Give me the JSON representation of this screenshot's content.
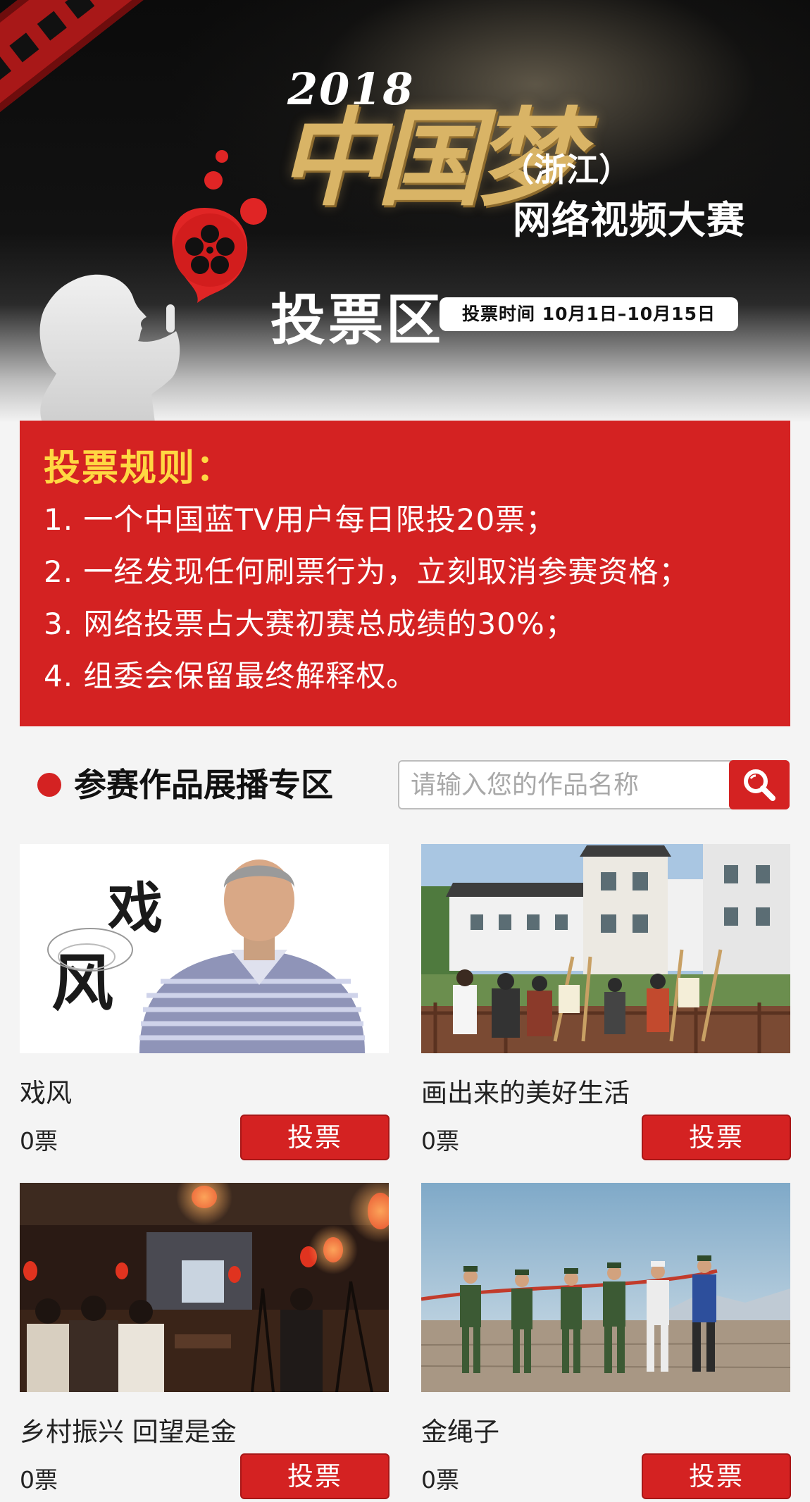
{
  "banner": {
    "year": "2018",
    "dream_title": "中国梦",
    "province": "（浙江）",
    "event": "网络视频大赛",
    "vote_area": "投票区",
    "vote_time": "投票时间 10月1日–10月15日"
  },
  "rules": {
    "title": "投票规则：",
    "items": [
      "1. 一个中国蓝TV用户每日限投20票；",
      "2. 一经发现任何刷票行为，立刻取消参赛资格；",
      "3. 网络投票占大赛初赛总成绩的30%；",
      "4. 组委会保留最终解释权。"
    ]
  },
  "section": {
    "title": "参赛作品展播专区"
  },
  "search": {
    "placeholder": "请输入您的作品名称",
    "icon": "search-icon"
  },
  "works": [
    {
      "title": "戏风",
      "votes": "0票",
      "button": "投票",
      "thumb_text_1": "戏",
      "thumb_text_2": "风"
    },
    {
      "title": "画出来的美好生活",
      "votes": "0票",
      "button": "投票"
    },
    {
      "title": "乡村振兴 回望是金",
      "votes": "0票",
      "button": "投票"
    },
    {
      "title": "金绳子",
      "votes": "0票",
      "button": "投票"
    }
  ],
  "colors": {
    "brand_red": "#d42222",
    "rules_title": "#ffd842",
    "gold": "#d9b466"
  }
}
